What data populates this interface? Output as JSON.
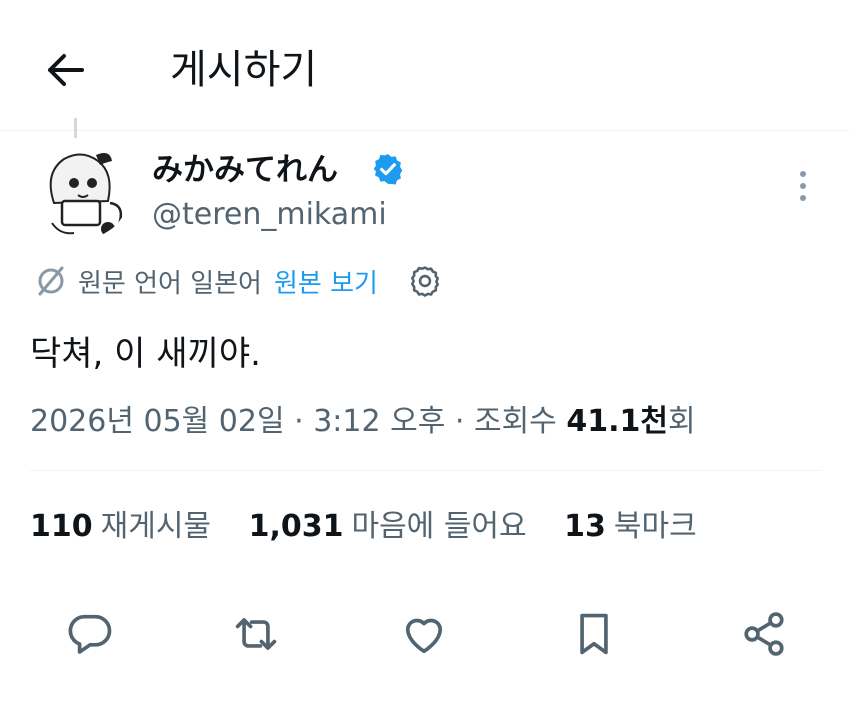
{
  "header": {
    "title": "게시하기",
    "back_icon": "back-arrow-icon"
  },
  "tweet": {
    "display_name": "みかみてれん",
    "handle": "@teren_mikami",
    "verified": true,
    "translation": {
      "notice": "원문 언어 일본어",
      "show_original_label": "원본 보기"
    },
    "text": "닥쳐, 이 새끼야.",
    "meta": {
      "date": "2026년 05월 02일",
      "time": "3:12 오후",
      "views_label": "조회수",
      "views_value": "41.1천",
      "views_suffix": "회",
      "separator": "·"
    }
  },
  "stats": [
    {
      "value": "110",
      "label": "재게시물"
    },
    {
      "value": "1,031",
      "label": "마음에 들어요"
    },
    {
      "value": "13",
      "label": "북마크"
    }
  ],
  "colors": {
    "accent": "#1d9bf0",
    "secondary_text": "#536471",
    "primary_text": "#0f1419"
  }
}
